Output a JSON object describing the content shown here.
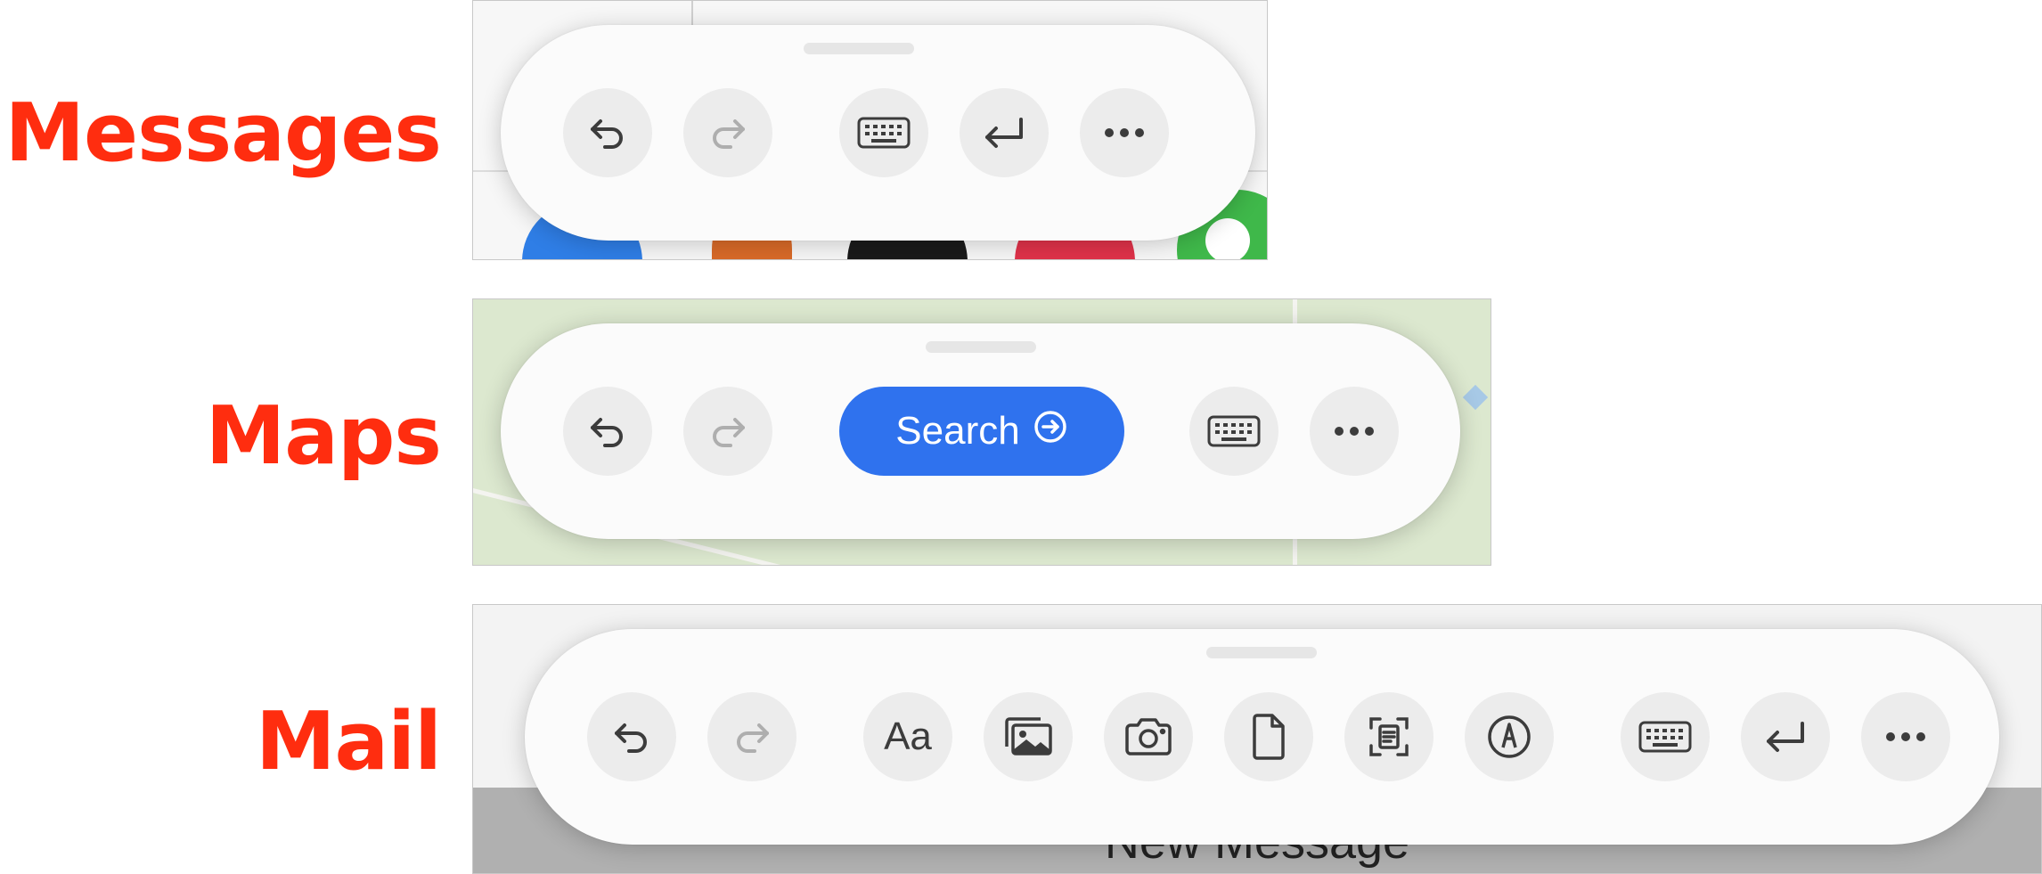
{
  "rows": {
    "messages": {
      "label": "Messages"
    },
    "maps": {
      "label": "Maps",
      "search_label": "Search"
    },
    "mail": {
      "label": "Mail",
      "format_label": "Aa",
      "background_title": "New Message"
    }
  },
  "colors": {
    "label": "#ff2d0f",
    "accent": "#2f72ee",
    "bar": "#fbfbfb",
    "button": "#ececec",
    "icon": "#3c3c3c"
  },
  "icons": {
    "messages": [
      "undo-icon",
      "redo-icon",
      "keyboard-icon",
      "return-icon",
      "more-icon"
    ],
    "maps": [
      "undo-icon",
      "redo-icon",
      "search-arrow-icon",
      "keyboard-icon",
      "more-icon"
    ],
    "mail": [
      "undo-icon",
      "redo-icon",
      "text-format-icon",
      "photo-library-icon",
      "camera-icon",
      "document-icon",
      "scan-document-icon",
      "markup-icon",
      "keyboard-icon",
      "return-icon",
      "more-icon"
    ]
  }
}
